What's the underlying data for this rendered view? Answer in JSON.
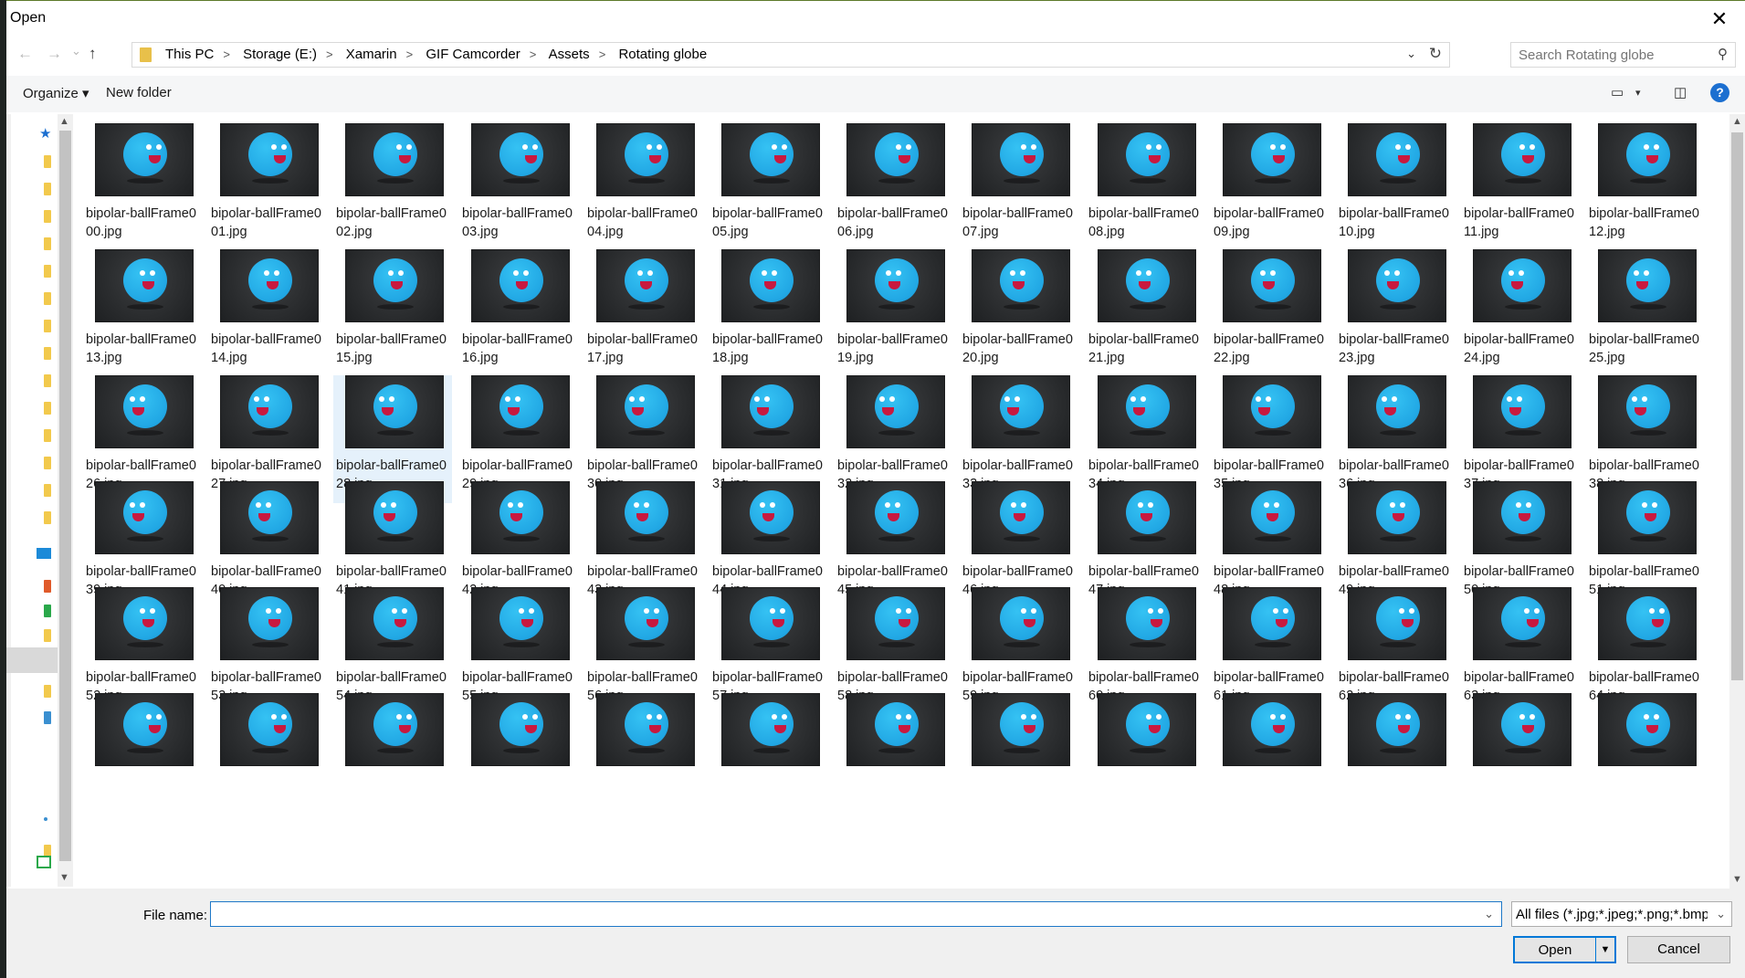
{
  "window": {
    "title": "Open",
    "close_glyph": "✕"
  },
  "nav": {
    "back_glyph": "←",
    "forward_glyph": "→",
    "recent_glyph": "⌄",
    "up_glyph": "↑",
    "sep_glyph": ">"
  },
  "address": {
    "crumbs": [
      "This PC",
      "Storage (E:)",
      "Xamarin",
      "GIF Camcorder",
      "Assets",
      "Rotating globe"
    ],
    "dropdown_glyph": "⌄",
    "refresh_glyph": "↻"
  },
  "search": {
    "placeholder": "Search Rotating globe",
    "icon": "search-icon",
    "glyph": "⚲"
  },
  "toolbar": {
    "organize_label": "Organize ▾",
    "new_folder_label": "New folder",
    "view_glyph": "▭",
    "view_dd_glyph": "▾",
    "preview_glyph": "◫",
    "help_glyph": "?"
  },
  "files": [
    "bipolar-ballFrame000.jpg",
    "bipolar-ballFrame001.jpg",
    "bipolar-ballFrame002.jpg",
    "bipolar-ballFrame003.jpg",
    "bipolar-ballFrame004.jpg",
    "bipolar-ballFrame005.jpg",
    "bipolar-ballFrame006.jpg",
    "bipolar-ballFrame007.jpg",
    "bipolar-ballFrame008.jpg",
    "bipolar-ballFrame009.jpg",
    "bipolar-ballFrame010.jpg",
    "bipolar-ballFrame011.jpg",
    "bipolar-ballFrame012.jpg",
    "bipolar-ballFrame013.jpg",
    "bipolar-ballFrame014.jpg",
    "bipolar-ballFrame015.jpg",
    "bipolar-ballFrame016.jpg",
    "bipolar-ballFrame017.jpg",
    "bipolar-ballFrame018.jpg",
    "bipolar-ballFrame019.jpg",
    "bipolar-ballFrame020.jpg",
    "bipolar-ballFrame021.jpg",
    "bipolar-ballFrame022.jpg",
    "bipolar-ballFrame023.jpg",
    "bipolar-ballFrame024.jpg",
    "bipolar-ballFrame025.jpg",
    "bipolar-ballFrame026.jpg",
    "bipolar-ballFrame027.jpg",
    "bipolar-ballFrame028.jpg",
    "bipolar-ballFrame029.jpg",
    "bipolar-ballFrame030.jpg",
    "bipolar-ballFrame031.jpg",
    "bipolar-ballFrame032.jpg",
    "bipolar-ballFrame033.jpg",
    "bipolar-ballFrame034.jpg",
    "bipolar-ballFrame035.jpg",
    "bipolar-ballFrame036.jpg",
    "bipolar-ballFrame037.jpg",
    "bipolar-ballFrame038.jpg",
    "bipolar-ballFrame039.jpg",
    "bipolar-ballFrame040.jpg",
    "bipolar-ballFrame041.jpg",
    "bipolar-ballFrame042.jpg",
    "bipolar-ballFrame043.jpg",
    "bipolar-ballFrame044.jpg",
    "bipolar-ballFrame045.jpg",
    "bipolar-ballFrame046.jpg",
    "bipolar-ballFrame047.jpg",
    "bipolar-ballFrame048.jpg",
    "bipolar-ballFrame049.jpg",
    "bipolar-ballFrame050.jpg",
    "bipolar-ballFrame051.jpg",
    "bipolar-ballFrame052.jpg",
    "bipolar-ballFrame053.jpg",
    "bipolar-ballFrame054.jpg",
    "bipolar-ballFrame055.jpg",
    "bipolar-ballFrame056.jpg",
    "bipolar-ballFrame057.jpg",
    "bipolar-ballFrame058.jpg",
    "bipolar-ballFrame059.jpg",
    "bipolar-ballFrame060.jpg",
    "bipolar-ballFrame061.jpg",
    "bipolar-ballFrame062.jpg",
    "bipolar-ballFrame063.jpg",
    "bipolar-ballFrame064.jpg"
  ],
  "partial_row_count": 13,
  "selected_file": "bipolar-ballFrame028.jpg",
  "footer": {
    "file_name_label": "File name:",
    "file_name_value": "",
    "file_type_value": "All files (*.jpg;*.jpeg;*.png;*.bmp",
    "open_label": "Open",
    "cancel_label": "Cancel",
    "dd_glyph": "⌄"
  },
  "colors": {
    "accent": "#0078d7",
    "ball": "#21a7e4",
    "thumb_bg": "#2a2c2e",
    "selection": "#e5f1fb"
  }
}
